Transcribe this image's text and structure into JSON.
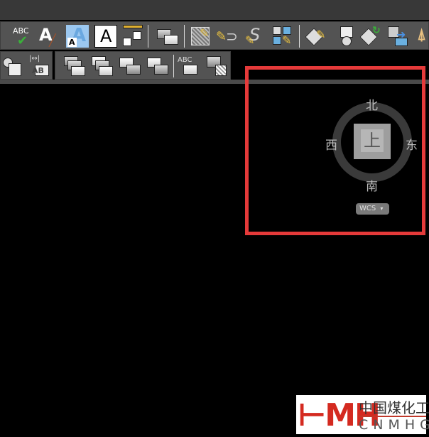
{
  "toolbar": {
    "row1": [
      {
        "name": "spell-check",
        "label": "ABC"
      },
      {
        "name": "text-style"
      },
      {
        "name": "text-height-highlighted",
        "label": "A"
      },
      {
        "name": "text-box",
        "label": "A"
      },
      {
        "name": "table-ruler"
      },
      {
        "name": "draw-order"
      },
      {
        "name": "hatch-edit"
      },
      {
        "name": "edit-arc"
      },
      {
        "name": "edit-spline"
      },
      {
        "name": "edit-array"
      },
      {
        "name": "attribute-edit"
      },
      {
        "name": "block-attributes"
      },
      {
        "name": "sync-attributes"
      },
      {
        "name": "attribute-extract"
      },
      {
        "name": "purge"
      }
    ],
    "row2": [
      {
        "name": "find-object"
      },
      {
        "name": "dimension-text",
        "label": "AB"
      },
      {
        "name": "bring-to-front"
      },
      {
        "name": "send-to-back"
      },
      {
        "name": "bring-above"
      },
      {
        "name": "send-under"
      },
      {
        "name": "text-to-front",
        "label": "ABC"
      },
      {
        "name": "hatch-to-back"
      }
    ]
  },
  "viewcube": {
    "north": "北",
    "south": "南",
    "east": "东",
    "west": "西",
    "face": "上",
    "ucs": "WCS",
    "ucs_arrow": "▾"
  },
  "highlight_color": "#e53a3a",
  "watermark": {
    "mark": "MH",
    "cn": "中国煤化工",
    "en": "CNMHG"
  }
}
